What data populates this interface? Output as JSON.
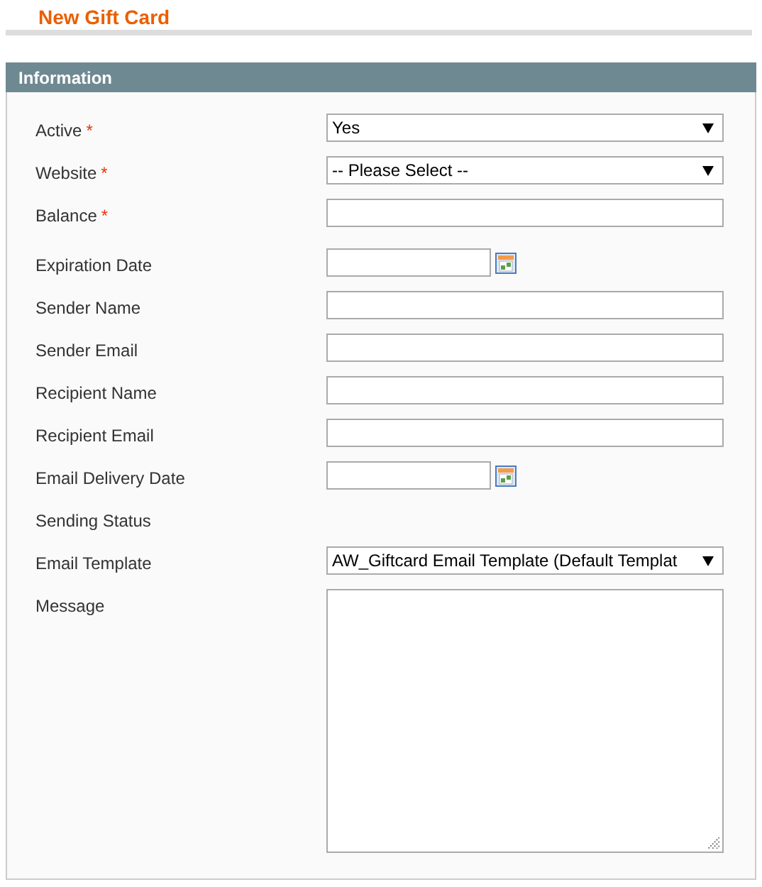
{
  "page_title": "New Gift Card",
  "section": {
    "title": "Information"
  },
  "fields": [
    {
      "label": "Active",
      "required_mark": "*",
      "kind": "select",
      "value": "Yes"
    },
    {
      "label": "Website",
      "required_mark": "*",
      "kind": "select",
      "value": "-- Please Select --"
    },
    {
      "label": "Balance",
      "required_mark": "*",
      "kind": "text"
    },
    {
      "label": "Expiration Date",
      "kind": "date"
    },
    {
      "label": "Sender Name",
      "kind": "text"
    },
    {
      "label": "Sender Email",
      "kind": "text"
    },
    {
      "label": "Recipient Name",
      "kind": "text"
    },
    {
      "label": "Recipient Email",
      "kind": "text"
    },
    {
      "label": "Email Delivery Date",
      "kind": "date"
    },
    {
      "label": "Sending Status",
      "kind": "static"
    },
    {
      "label": "Email Template",
      "kind": "select",
      "value": "AW_Giftcard Email Template (Default Templat"
    },
    {
      "label": "Message",
      "kind": "textarea"
    }
  ]
}
